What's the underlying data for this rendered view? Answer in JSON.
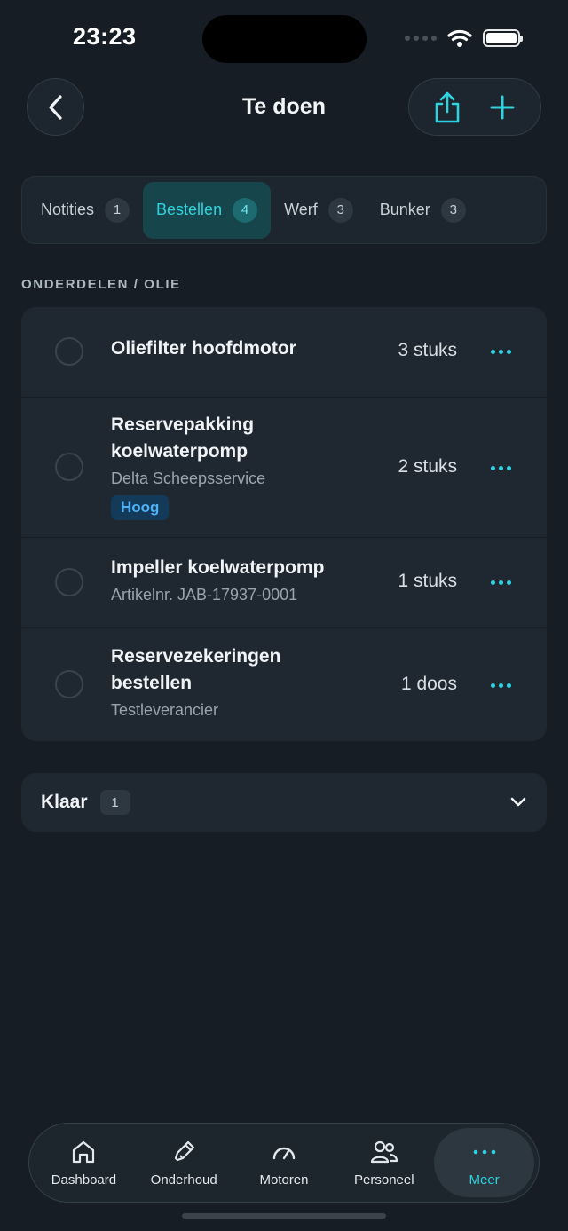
{
  "status_bar": {
    "time": "23:23"
  },
  "header": {
    "title": "Te doen"
  },
  "tabs": [
    {
      "label": "Notities",
      "count": "1",
      "active": false
    },
    {
      "label": "Bestellen",
      "count": "4",
      "active": true
    },
    {
      "label": "Werf",
      "count": "3",
      "active": false
    },
    {
      "label": "Bunker",
      "count": "3",
      "active": false
    }
  ],
  "section": {
    "title": "ONDERDELEN / OLIE"
  },
  "items": [
    {
      "title_line1": "Oliefilter hoofdmotor",
      "title_line2": "",
      "subtitle": "",
      "badge": "",
      "quantity": "3 stuks"
    },
    {
      "title_line1": "Reservepakking",
      "title_line2": "koelwaterpomp",
      "subtitle": "Delta Scheepsservice",
      "badge": "Hoog",
      "quantity": "2 stuks"
    },
    {
      "title_line1": "Impeller koelwaterpomp",
      "title_line2": "",
      "subtitle": "Artikelnr. JAB-17937-0001",
      "badge": "",
      "quantity": "1 stuks"
    },
    {
      "title_line1": "Reservezekeringen",
      "title_line2": "bestellen",
      "subtitle": "Testleverancier",
      "badge": "",
      "quantity": "1 doos"
    }
  ],
  "done_group": {
    "label": "Klaar",
    "count": "1"
  },
  "bottom_nav": [
    {
      "label": "Dashboard",
      "icon": "home-icon",
      "active": false
    },
    {
      "label": "Onderhoud",
      "icon": "wrench-icon",
      "active": false
    },
    {
      "label": "Motoren",
      "icon": "gauge-icon",
      "active": false
    },
    {
      "label": "Personeel",
      "icon": "people-icon",
      "active": false
    },
    {
      "label": "Meer",
      "icon": "more-icon",
      "active": true
    }
  ],
  "colors": {
    "accent": "#2ed3df",
    "background": "#161d24",
    "card": "#1f2830",
    "badge_high": "#4fb0f5"
  }
}
